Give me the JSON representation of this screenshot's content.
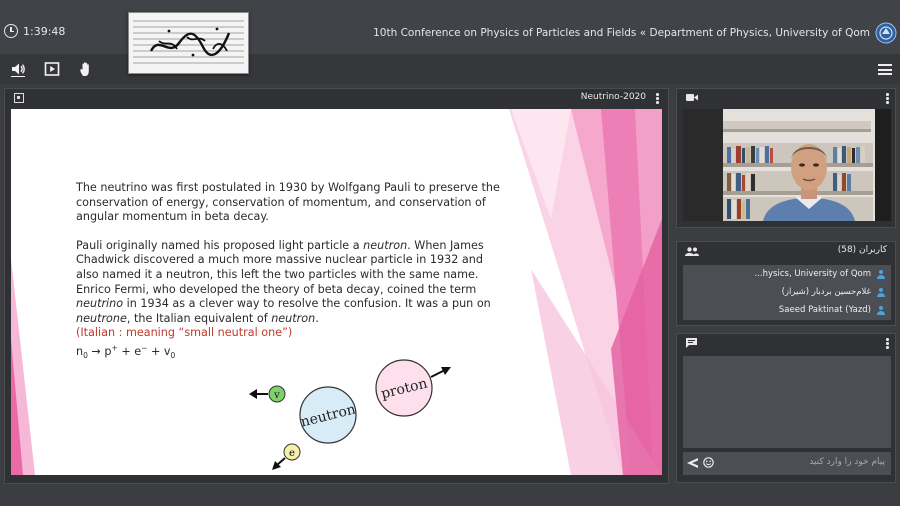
{
  "header": {
    "time": "1:39:48",
    "title": "10th Conference on Physics of Particles and Fields « Department of Physics, University of Qom"
  },
  "toolbar": {
    "audio_icon": "speaker-icon",
    "share_icon": "play-square-icon",
    "hand_icon": "raise-hand-icon",
    "menu_icon": "hamburger-menu-icon"
  },
  "presentation": {
    "title": "Neutrino-2020",
    "paragraph1": "The neutrino was first postulated in 1930 by Wolfgang Pauli to preserve the conservation of energy, conservation of momentum, and conservation of angular momentum in beta decay.",
    "p2_part1": "Pauli originally named his proposed light particle a ",
    "p2_em1": "neutron",
    "p2_part2": ". When James Chadwick discovered a much more massive nuclear particle in 1932 and also named it a neutron, this left the two particles with the same name. Enrico Fermi, who developed the theory of beta decay, coined the term ",
    "p2_em2": "neutrino",
    "p2_part3": " in 1934 as a clever way to resolve the confusion. It was a pun on ",
    "p2_em3": "neutrone",
    "p2_part4": ", the Italian equivalent of ",
    "p2_em4": "neutron",
    "p2_part5": ".",
    "italian_note": "(Italian : meaning “small neutral one”)",
    "eq_n": "n",
    "eq_n_sub": "0",
    "eq_arrow": " → p",
    "eq_p_sup": "+",
    "eq_plus_e": " + e",
    "eq_e_sup": "−",
    "eq_plus_v": " + v",
    "eq_v_sub": "0",
    "diagram": {
      "neutron": "neutron",
      "proton": "proton",
      "nu": "v",
      "electron": "e"
    }
  },
  "webcam": {
    "icon": "video-camera-icon"
  },
  "users": {
    "title": "کاربران (58)",
    "list": [
      "...hysics, University of Qom",
      "غلام‌حسین بردبار (شیراز)",
      "Saeed Paktinat (Yazd)"
    ]
  },
  "chat": {
    "placeholder": "پیام خود را وارد کنید",
    "icon": "chat-icon",
    "send_icon": "send-icon",
    "emoji_icon": "smiley-icon"
  },
  "colors": {
    "accent_blue": "#4aa3df",
    "slide_pink": "#e86aa6",
    "note_red": "#c0392b"
  }
}
